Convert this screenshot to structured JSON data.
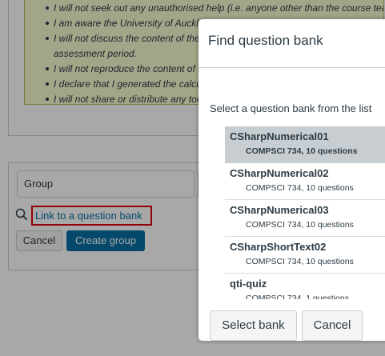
{
  "background": {
    "notice_items": [
      {
        "text": "I will not seek out any unauthorised help (i.e. anyone other than the course teaching staff)",
        "bullet": true
      },
      {
        "text": "I am aware the University of Auckland may use plagiarism detection tools to check",
        "bullet": true
      },
      {
        "text": "I will not discuss the content of the",
        "bullet": true
      },
      {
        "text": "assessment period.",
        "bullet": false
      },
      {
        "text": "I will not reproduce the content of t",
        "bullet": true
      },
      {
        "text": "I declare that I generated the calcu",
        "bullet": true
      },
      {
        "text": "I will not share or distribute any too",
        "bullet": true
      }
    ],
    "group_placeholder": "Group",
    "link_to_bank": "Link to a question bank",
    "cancel_label": "Cancel",
    "create_group_label": "Create group",
    "accent_color": "#0770a3",
    "highlight_color": "#e0040b"
  },
  "dialog": {
    "title": "Find question bank",
    "instruction": "Select a question bank from the list",
    "banks": [
      {
        "name": "CSharpNumerical01",
        "detail": "COMPSCI 734, 10 questions",
        "selected": true
      },
      {
        "name": "CSharpNumerical02",
        "detail": "COMPSCI 734, 10 questions",
        "selected": false
      },
      {
        "name": "CSharpNumerical03",
        "detail": "COMPSCI 734, 10 questions",
        "selected": false
      },
      {
        "name": "CSharpShortText02",
        "detail": "COMPSCI 734, 10 questions",
        "selected": false
      },
      {
        "name": "qti-quiz",
        "detail": "COMPSCI 734, 1 questions",
        "selected": false
      }
    ],
    "select_bank_label": "Select bank",
    "cancel_label": "Cancel"
  }
}
